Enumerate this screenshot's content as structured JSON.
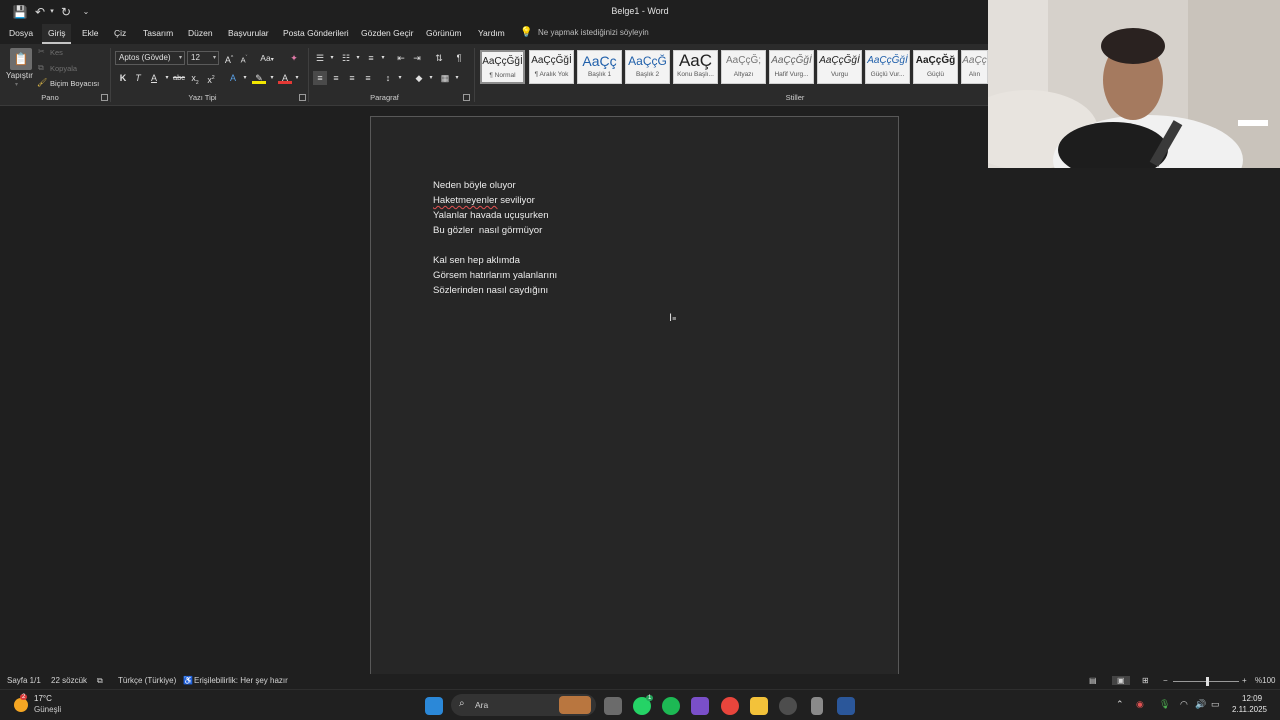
{
  "window": {
    "title": "Belge1  -  Word"
  },
  "tabs": [
    "Dosya",
    "Giriş",
    "Ekle",
    "Çiz",
    "Tasarım",
    "Düzen",
    "Başvurular",
    "Posta Gönderileri",
    "Gözden Geçir",
    "Görünüm",
    "Yardım"
  ],
  "active_tab": "Giriş",
  "tell_me": "Ne yapmak istediğinizi söyleyin",
  "clipboard": {
    "paste": "Yapıştır",
    "cut": "Kes",
    "copy": "Kopyala",
    "format_painter": "Biçim Boyacısı",
    "group": "Pano"
  },
  "font": {
    "name": "Aptos (Gövde)",
    "size": "12",
    "case": "Aa",
    "bold": "K",
    "italic": "T",
    "underline": "A",
    "strike": "abc",
    "sub": "x",
    "sup": "x",
    "group": "Yazı Tipi"
  },
  "paragraph": {
    "group": "Paragraf"
  },
  "styles": {
    "group": "Stiller",
    "items": [
      {
        "preview": "AaÇçĞğİ",
        "name": "¶ Normal"
      },
      {
        "preview": "AaÇçĞğİ",
        "name": "¶ Aralık Yok"
      },
      {
        "preview": "AaÇç",
        "name": "Başlık 1"
      },
      {
        "preview": "AaÇçĞ",
        "name": "Başlık 2"
      },
      {
        "preview": "AaÇ",
        "name": "Konu Başlı..."
      },
      {
        "preview": "AaÇçĞ;",
        "name": "Altyazı"
      },
      {
        "preview": "AaÇçĞğİ",
        "name": "Hafif Vurg..."
      },
      {
        "preview": "AaÇçĞğİ",
        "name": "Vurgu"
      },
      {
        "preview": "AaÇçĞğİ",
        "name": "Güçlü Vur..."
      },
      {
        "preview": "AaÇçĞğ",
        "name": "Güçlü"
      },
      {
        "preview": "AaÇç",
        "name": "Alın"
      }
    ]
  },
  "document": {
    "lines": [
      "Neden böyle oluyor",
      "Haketmeyenler sevliliyor",
      "Yalanlar havada uçuşurken",
      "Bu gözler  nasıl görmüyor",
      "",
      "Kal sen hep aklımda",
      "Görsem hatırlarım yalanlarını",
      "Sözlerinden nasıl caydığını"
    ],
    "misspelled_word": "Haketmeyenler",
    "line2_rest": " seviliyor"
  },
  "status": {
    "page": "Sayfa 1/1",
    "words": "22 sözcük",
    "language": "Türkçe (Türkiye)",
    "accessibility": "Erişilebilirlik: Her şey hazır",
    "zoom": "%100",
    "zoom_percent": 100
  },
  "taskbar": {
    "weather_temp": "17°C",
    "weather_desc": "Güneşli",
    "weather_badge": "2",
    "search_placeholder": "Ara",
    "whatsapp_badge": "1",
    "time": "12:09",
    "date": "2.11.2025"
  },
  "colors": {
    "accent_word": "#2b579a",
    "spell_error": "#e05252",
    "highlight_yellow": "#f2e600",
    "font_color_red": "#e53935"
  }
}
